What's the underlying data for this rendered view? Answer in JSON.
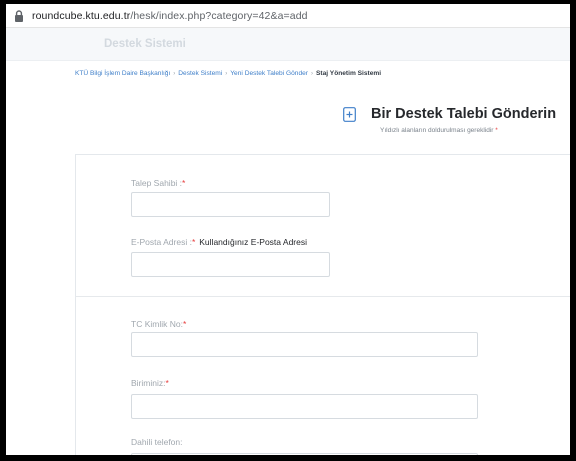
{
  "browser": {
    "url_host": "roundcube.ktu.edu.tr",
    "url_path": "/hesk/index.php?category=42&a=add"
  },
  "site": {
    "title": "Destek Sistemi"
  },
  "breadcrumb": [
    "KTÜ Bilgi İşlem Daire Başkanlığı",
    "Destek Sistemi",
    "Yeni Destek Talebi Gönder",
    "Staj Yönetim Sistemi"
  ],
  "page": {
    "heading": "Bir Destek Talebi Gönderin",
    "subheading": "Yıldızlı alanların doldurulması gereklidir",
    "required_mark": "*"
  },
  "form": {
    "requester_label": "Talep Sahibi :",
    "email_label": "E-Posta Adresi :",
    "email_hint": "Kullandığınız E-Posta Adresi",
    "tc_label": "TC Kimlik No:",
    "unit_label": "Biriminiz:",
    "phone_label": "Dahili telefon:",
    "requester_value": "",
    "email_value": "",
    "tc_value": "",
    "unit_value": ""
  },
  "colors": {
    "link": "#3f7fc9",
    "required": "#e63b3b",
    "header_bg": "#f6f8fa"
  }
}
